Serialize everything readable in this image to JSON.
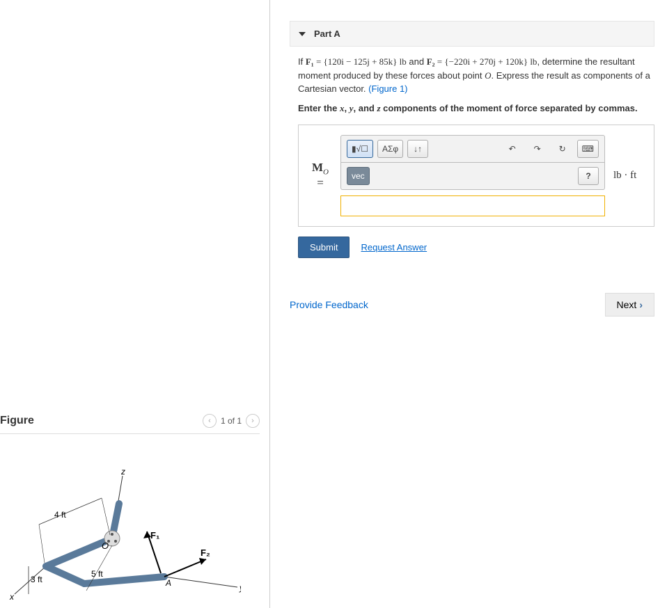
{
  "figure": {
    "title": "Figure",
    "pager": "1 of 1",
    "labels": {
      "z": "z",
      "y": "y",
      "x": "x",
      "O": "O",
      "A": "A",
      "F1": "F₁",
      "F2": "F₂",
      "d_top": "4 ft",
      "d_left": "3 ft",
      "d_bottom": "5 ft"
    }
  },
  "part": {
    "title": "Part A",
    "intro_pre": "If ",
    "F1_lhs": "F₁",
    "eq": " = ",
    "F1_rhs": "{120i − 125j + 85k} lb",
    "and": " and ",
    "F2_lhs": "F₂",
    "F2_rhs": "{−220i + 270j + 120k} lb",
    "intro_post": ", determine the resultant moment produced by these forces about point ",
    "pointO": "O",
    "intro_tail": ". Express the result as components of a Cartesian vector. ",
    "figref": "(Figure 1)",
    "instr": "Enter the x, y, and z components of the moment of force separated by commas.",
    "var": "M",
    "varsub": "O",
    "vareq": "=",
    "unit": "lb · ft",
    "toolbar": {
      "templates": "▮√☐",
      "greek": "ΑΣφ",
      "subsup": "↓↑",
      "undo": "↶",
      "redo": "↷",
      "reset": "↻",
      "keyboard": "⌨",
      "vec": "vec",
      "help": "?"
    },
    "submit": "Submit",
    "request": "Request Answer",
    "provide": "Provide Feedback",
    "next": "Next"
  }
}
